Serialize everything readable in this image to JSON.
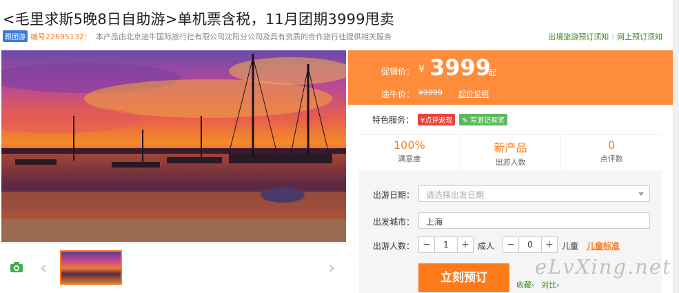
{
  "title": "<毛里求斯5晚8日自助游>单机票含税，11月团期3999甩卖",
  "subline": {
    "tag": "跟团游",
    "code": "编号22695132：",
    "desc": "本产品由北京途牛国际旅行社有限公司沈阳分公司及具有资质的合作旅行社提供相关服务"
  },
  "top_links": [
    "出境旅游预订须知",
    "网上预订须知"
  ],
  "gallery": {
    "camera_icon": "camera-icon",
    "prev": "‹",
    "next": "›"
  },
  "price": {
    "label": "促销价：",
    "currency": "¥",
    "amount": "3999",
    "suffix": "起",
    "tuniu_label": "途牛价：",
    "tuniu_price": "¥3999",
    "qijia_link": "起价说明"
  },
  "features": {
    "label": "特色服务：",
    "badge1": "¥点评返现",
    "badge2": "写游记有奖"
  },
  "stats": [
    {
      "value": "100%",
      "label": "满意度"
    },
    {
      "value": "新产品",
      "label": "出游人数"
    },
    {
      "value": "0",
      "label": "点评数"
    }
  ],
  "form": {
    "date_label": "出游日期：",
    "date_placeholder": "请选择出发日期",
    "city_label": "出发城市：",
    "city_value": "上海",
    "people_label": "出游人数：",
    "adult_count": "1",
    "adult_unit": "成人",
    "child_count": "0",
    "child_unit": "儿童",
    "child_std": "儿童标准",
    "minus": "−",
    "plus": "+",
    "book": "立刻预订",
    "fav": "收藏›",
    "compare": "对比›"
  },
  "watermark": "eLvXing.net",
  "colors": {
    "accent": "#ff7b1a",
    "price_bg": "#ff8c3b",
    "link_green": "#3c8a1e"
  }
}
